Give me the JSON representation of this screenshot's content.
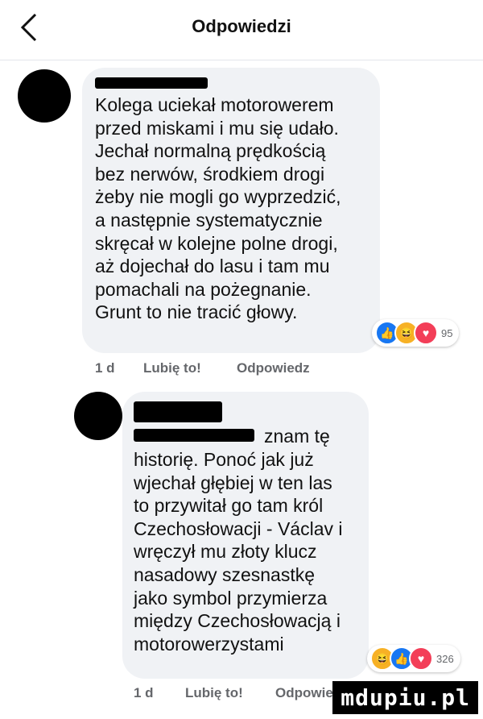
{
  "header": {
    "title": "Odpowiedzi",
    "back_icon": "chevron-left-icon"
  },
  "comments": [
    {
      "text": "Kolega uciekał motorowerem\nprzed miskami i mu się udało.\nJechał normalną prędkością\nbez nerwów, środkiem drogi\nżeby nie mogli go wyprzedzić,\na następnie systematycznie\nskręcał w kolejne polne drogi,\naż dojechał do lasu i tam mu\npomachali na pożegnanie.\nGrunt to nie tracić głowy.",
      "time": "1 d",
      "like_label": "Lubię to!",
      "reply_label": "Odpowiedz",
      "reactions": [
        "like",
        "haha",
        "love"
      ],
      "reaction_count": "95"
    },
    {
      "inline_text": "znam tę",
      "text": "historię. Ponoć jak już\nwjechał głębiej w ten las\nto przywitał go tam król\nCzechosłowacji - Václav i\nwręczył mu złoty klucz\nnasadowy szesnastkę\njako symbol przymierza\nmiędzy Czechosłowacją i\nmotorowerzystami",
      "time": "1 d",
      "like_label": "Lubię to!",
      "reply_label": "Odpowiedz",
      "reactions": [
        "haha",
        "like",
        "love"
      ],
      "reaction_count": "326"
    }
  ],
  "watermark": "mdupiu.pl",
  "colors": {
    "bubble": "#f0f2f5",
    "meta": "#65676b",
    "like": "#1877f2",
    "love": "#f33e58",
    "haha": "#f7b125"
  }
}
